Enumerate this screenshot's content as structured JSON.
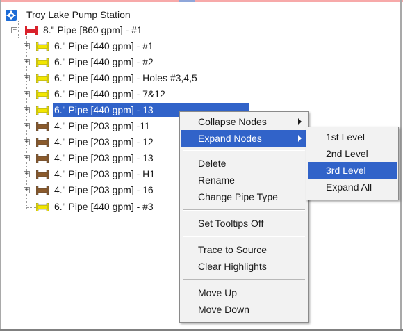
{
  "tree": {
    "root": {
      "label": "Troy Lake Pump Station",
      "icon": "gear-icon",
      "icon_color": "#1c6bd6"
    },
    "main_pipe": {
      "label": "8.\" Pipe [860 gpm] - #1",
      "icon": "red-pipe-icon",
      "color": "#d9212b"
    },
    "children": [
      {
        "label": "6.\" Pipe [440 gpm] - #1",
        "color": "#f2e600"
      },
      {
        "label": "6.\" Pipe [440 gpm] - #2",
        "color": "#f2e600"
      },
      {
        "label": "6.\" Pipe [440 gpm] - Holes #3,4,5",
        "color": "#f2e600"
      },
      {
        "label": "6.\" Pipe [440 gpm] - 7&12",
        "color": "#f2e600"
      },
      {
        "label": "6.\" Pipe [440 gpm] - 13",
        "color": "#f2e600",
        "selected": true
      },
      {
        "label": "4.\" Pipe [203 gpm] -11",
        "color": "#8b5a2b"
      },
      {
        "label": "4.\" Pipe [203 gpm] - 12",
        "color": "#8b5a2b"
      },
      {
        "label": "4.\" Pipe [203 gpm] - 13",
        "color": "#8b5a2b"
      },
      {
        "label": "4.\" Pipe [203 gpm] - H1",
        "color": "#8b5a2b"
      },
      {
        "label": "4.\" Pipe [203 gpm] - 16",
        "color": "#8b5a2b"
      },
      {
        "label": "6.\" Pipe [440 gpm] - #3",
        "color": "#f2e600",
        "leaf": true
      }
    ]
  },
  "context_menu": {
    "items": [
      {
        "label": "Collapse Nodes",
        "submenu": true
      },
      {
        "label": "Expand Nodes",
        "submenu": true,
        "active": true
      },
      {
        "separator": true
      },
      {
        "label": "Delete"
      },
      {
        "label": "Rename"
      },
      {
        "label": "Change Pipe Type"
      },
      {
        "separator": true
      },
      {
        "label": "Set Tooltips Off"
      },
      {
        "separator": true
      },
      {
        "label": "Trace to Source"
      },
      {
        "label": "Clear Highlights"
      },
      {
        "separator": true
      },
      {
        "label": "Move Up"
      },
      {
        "label": "Move Down"
      }
    ]
  },
  "submenu": {
    "items": [
      {
        "label": "1st Level"
      },
      {
        "label": "2nd Level"
      },
      {
        "label": "3rd Level",
        "active": true
      },
      {
        "label": "Expand All"
      }
    ]
  },
  "colors": {
    "selection": "#3163c9",
    "menu_bg": "#f2f2f2"
  }
}
